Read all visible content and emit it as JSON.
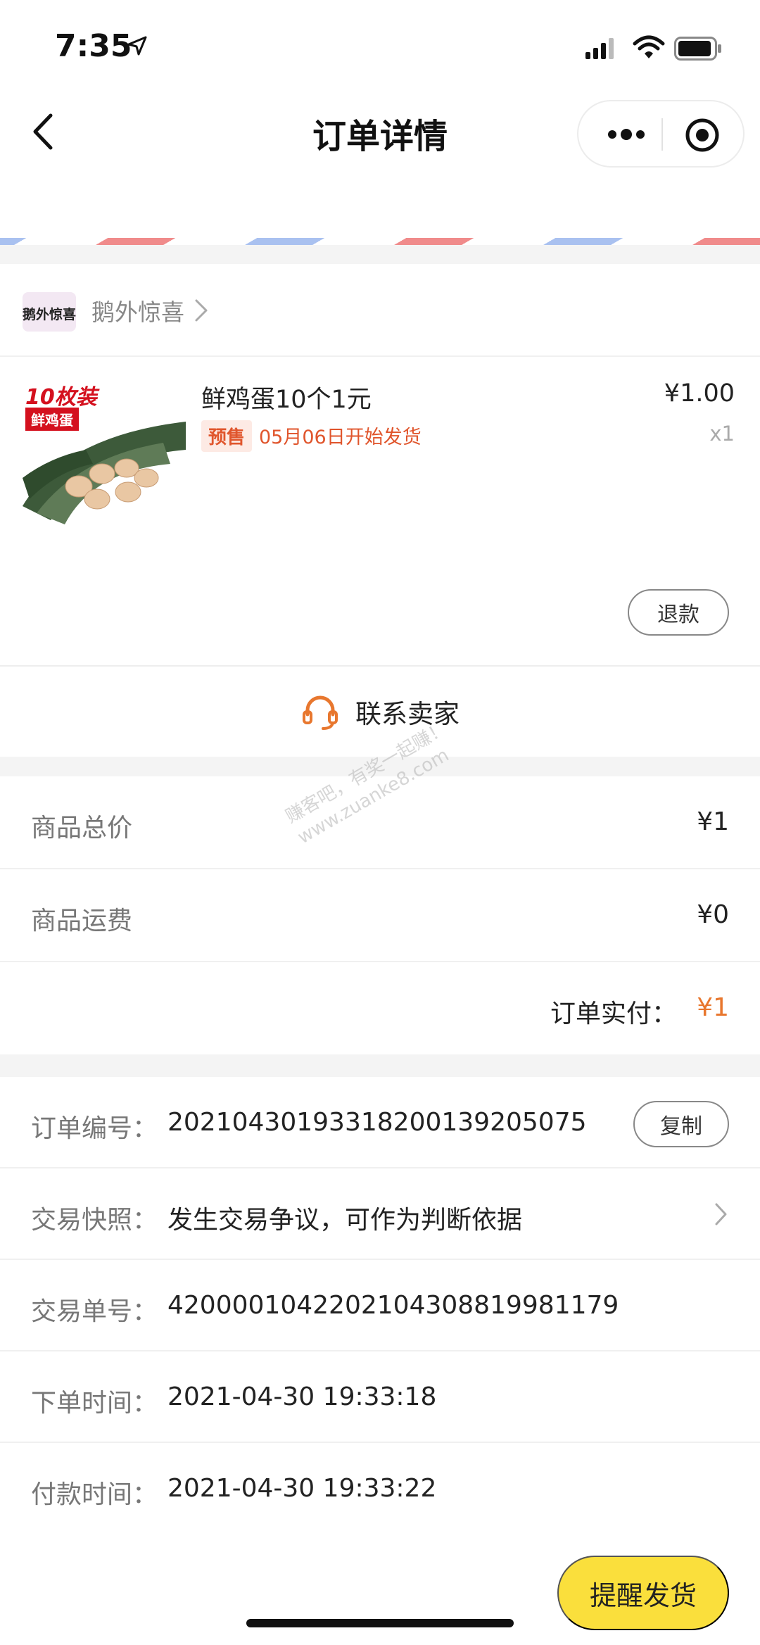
{
  "status_bar": {
    "time": "7:35"
  },
  "nav": {
    "title": "订单详情"
  },
  "store": {
    "name": "鹅外惊喜",
    "logo_text": "鹅外惊喜"
  },
  "product": {
    "image_tag": "10枚装",
    "image_sub": "鲜鸡蛋",
    "title": "鲜鸡蛋10个1元",
    "presale_badge": "预售",
    "ship_date": "05月06日开始发货",
    "price": "¥1.00",
    "quantity": "x1",
    "refund_label": "退款"
  },
  "contact": {
    "label": "联系卖家"
  },
  "summary": {
    "rows": [
      {
        "label": "商品总价",
        "value": "¥1"
      },
      {
        "label": "商品运费",
        "value": "¥0"
      }
    ],
    "paid_label": "订单实付：",
    "paid_value": "¥1"
  },
  "order_info": {
    "order_no_label": "订单编号：",
    "order_no": "20210430193318200139205075",
    "copy_label": "复制",
    "snapshot_label": "交易快照：",
    "snapshot_value": "发生交易争议，可作为判断依据",
    "trade_no_label": "交易单号：",
    "trade_no": "4200001042202104308819981179",
    "order_time_label": "下单时间：",
    "order_time": "2021-04-30 19:33:18",
    "pay_time_label": "付款时间：",
    "pay_time": "2021-04-30 19:33:22"
  },
  "remind_button": "提醒发货",
  "watermark": {
    "line1": "赚客吧，有奖一起赚！",
    "line2": "www.zuanke8.com"
  },
  "colors": {
    "accent_orange": "#e8772e",
    "presale_red": "#e0552c",
    "remind_yellow": "#fadf3c"
  }
}
